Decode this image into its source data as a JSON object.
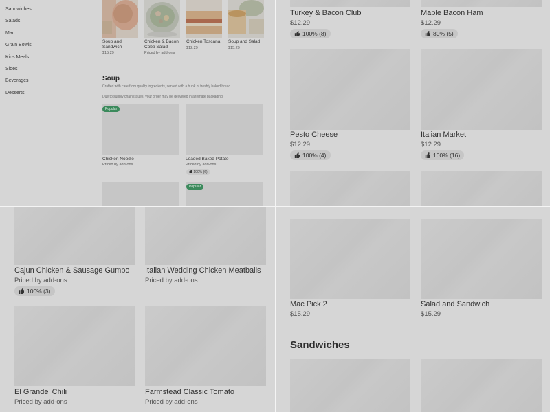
{
  "sidebar": {
    "items": [
      "Sandwiches",
      "Salads",
      "Mac",
      "Grain Bowls",
      "Kids Meals",
      "Sides",
      "Beverages",
      "Desserts"
    ]
  },
  "top_row": [
    {
      "name_l1": "Soup and",
      "name_l2": "Sandwich",
      "price": "$15.29"
    },
    {
      "name_l1": "Chicken & Bacon",
      "name_l2": "Cobb Salad",
      "price": "Priced by add-ons"
    },
    {
      "name_l1": "Chicken Toscana",
      "name_l2": "",
      "price": "$12.29"
    },
    {
      "name_l1": "Soup and Salad",
      "name_l2": "",
      "price": "$15.29"
    }
  ],
  "soup_section": {
    "title": "Soup",
    "description": "Crafted with care from quality ingredients, served with a hunk of freshly baked bread.",
    "notice": "Due to supply chain issues, your order may be delivered in alternate packaging.",
    "badge": "Popular",
    "items": [
      {
        "name": "Chicken Noodle",
        "price": "Priced by add-ons",
        "rating": ""
      },
      {
        "name": "Loaded Baked Potato",
        "price": "Priced by add-ons",
        "rating": "100% (6)"
      }
    ],
    "badge2": "Popular"
  },
  "top_right": [
    {
      "name": "Turkey & Bacon Club",
      "price": "$12.29",
      "rating": "100% (8)"
    },
    {
      "name": "Maple Bacon Ham",
      "price": "$12.29",
      "rating": "80% (5)"
    },
    {
      "name": "Pesto Cheese",
      "price": "$12.29",
      "rating": "100% (4)"
    },
    {
      "name": "Italian Market",
      "price": "$12.29",
      "rating": "100% (16)"
    }
  ],
  "bottom_left": [
    {
      "name": "Cajun Chicken & Sausage Gumbo",
      "price": "Priced by add-ons",
      "rating": "100% (3)"
    },
    {
      "name": "Italian Wedding Chicken Meatballs",
      "price": "Priced by add-ons",
      "rating": ""
    },
    {
      "name": "El Grande' Chili",
      "price": "Priced by add-ons"
    },
    {
      "name": "Farmstead Classic Tomato",
      "price": "Priced by add-ons"
    }
  ],
  "bottom_right": {
    "items": [
      {
        "name": "Mac Pick 2",
        "price": "$15.29"
      },
      {
        "name": "Salad and Sandwich",
        "price": "$15.29"
      }
    ],
    "section_title": "Sandwiches"
  },
  "colors": {
    "overlay": "#d6d6d6",
    "badge": "#3b8a5c"
  },
  "icons": {
    "rating": "thumbs-up-icon"
  }
}
